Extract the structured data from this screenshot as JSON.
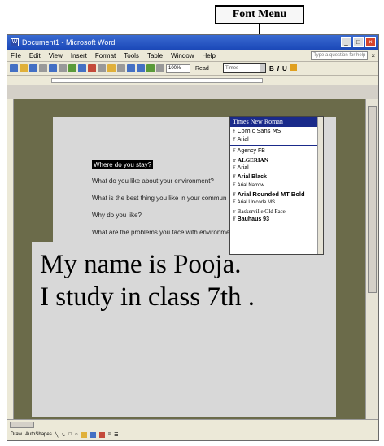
{
  "callout": {
    "label": "Font Menu"
  },
  "window": {
    "title": "Document1 - Microsoft Word"
  },
  "menu": [
    "File",
    "Edit",
    "View",
    "Insert",
    "Format",
    "Tools",
    "Table",
    "Window",
    "Help"
  ],
  "ask_box": "Type a question for help",
  "toolbar": {
    "zoom": "100%",
    "read": "Read",
    "font_current": "Times"
  },
  "document": {
    "questions": [
      "Where do you stay?",
      "What do you like about your environment?",
      "What is the best thing you like in your commun",
      "Why do you like?",
      "What are the problems you face with environment?"
    ],
    "big_line1": "My name is Pooja.",
    "big_line2": "I study in class 7th ."
  },
  "font_dropdown": {
    "selected": "Times New Roman",
    "recent": [
      "Comic Sans MS",
      "Arial"
    ],
    "all": [
      "Agency FB",
      "ALGERIAN",
      "Arial",
      "Arial Black",
      "Arial Narrow",
      "Arial Rounded MT Bold",
      "Arial Unicode MS",
      "Baskerville Old Face",
      "Bauhaus 93"
    ]
  },
  "drawbar": {
    "draw": "Draw",
    "autoshapes": "AutoShapes"
  }
}
